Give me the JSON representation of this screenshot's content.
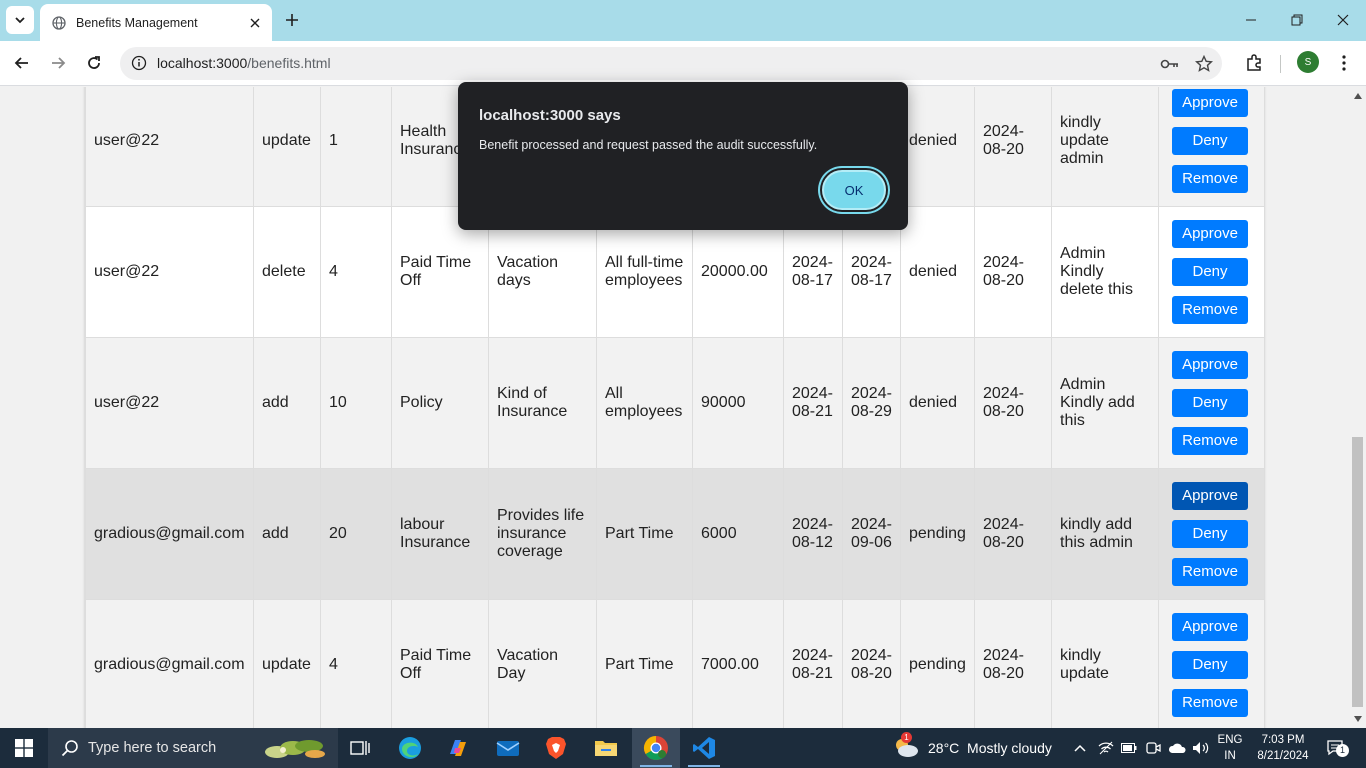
{
  "browser": {
    "tab_title": "Benefits Management",
    "url_host": "localhost:3000",
    "url_path": "/benefits.html"
  },
  "dialog": {
    "title": "localhost:3000 says",
    "message": "Benefit processed and request passed the audit successfully.",
    "ok_label": "OK"
  },
  "table": {
    "rows": [
      {
        "user": "user@22",
        "action": "update",
        "id": "1",
        "name_l1": "Health",
        "name_l2": "Insurance",
        "desc_l1": "",
        "desc_l2": "",
        "desc_l3": "",
        "elig_l1": "",
        "elig_l2": "",
        "amount": "",
        "start_l1": "",
        "start_l2": "",
        "end_l1": "",
        "end_l2": "",
        "status": "denied",
        "req_l1": "2024-",
        "req_l2": "08-20",
        "comment_l1": "kindly",
        "comment_l2": "update",
        "comment_l3": "admin",
        "approve": "Approve",
        "deny": "Deny",
        "remove": "Remove"
      },
      {
        "user": "user@22",
        "action": "delete",
        "id": "4",
        "name_l1": "Paid Time",
        "name_l2": "Off",
        "desc_l1": "Vacation",
        "desc_l2": "days",
        "desc_l3": "",
        "elig_l1": "All full-time",
        "elig_l2": "employees",
        "amount": "20000.00",
        "start_l1": "2024-",
        "start_l2": "08-17",
        "end_l1": "2024-",
        "end_l2": "08-17",
        "status": "denied",
        "req_l1": "2024-",
        "req_l2": "08-20",
        "comment_l1": "Admin",
        "comment_l2": "Kindly",
        "comment_l3": "delete this",
        "approve": "Approve",
        "deny": "Deny",
        "remove": "Remove"
      },
      {
        "user": "user@22",
        "action": "add",
        "id": "10",
        "name_l1": "Policy",
        "name_l2": "",
        "desc_l1": "Kind of",
        "desc_l2": "Insurance",
        "desc_l3": "",
        "elig_l1": "All",
        "elig_l2": "employees",
        "amount": "90000",
        "start_l1": "2024-",
        "start_l2": "08-21",
        "end_l1": "2024-",
        "end_l2": "08-29",
        "status": "denied",
        "req_l1": "2024-",
        "req_l2": "08-20",
        "comment_l1": "Admin",
        "comment_l2": "Kindly add",
        "comment_l3": "this",
        "approve": "Approve",
        "deny": "Deny",
        "remove": "Remove"
      },
      {
        "user": "gradious@gmail.com",
        "action": "add",
        "id": "20",
        "name_l1": "labour",
        "name_l2": "Insurance",
        "desc_l1": "Provides life",
        "desc_l2": "insurance",
        "desc_l3": "coverage",
        "elig_l1": "Part Time",
        "elig_l2": "",
        "amount": "6000",
        "start_l1": "2024-",
        "start_l2": "08-12",
        "end_l1": "2024-",
        "end_l2": "09-06",
        "status": "pending",
        "req_l1": "2024-",
        "req_l2": "08-20",
        "comment_l1": "kindly add",
        "comment_l2": "this admin",
        "comment_l3": "",
        "approve": "Approve",
        "deny": "Deny",
        "remove": "Remove"
      },
      {
        "user": "gradious@gmail.com",
        "action": "update",
        "id": "4",
        "name_l1": "Paid Time",
        "name_l2": "Off",
        "desc_l1": "Vacation",
        "desc_l2": "Day",
        "desc_l3": "",
        "elig_l1": "Part Time",
        "elig_l2": "",
        "amount": "7000.00",
        "start_l1": "2024-",
        "start_l2": "08-21",
        "end_l1": "2024-",
        "end_l2": "08-20",
        "status": "pending",
        "req_l1": "2024-",
        "req_l2": "08-20",
        "comment_l1": "kindly",
        "comment_l2": "update",
        "comment_l3": "",
        "approve": "Approve",
        "deny": "Deny",
        "remove": "Remove"
      }
    ]
  },
  "taskbar": {
    "search_placeholder": "Type here to search",
    "weather": "28°C  Mostly cloudy",
    "weather_badge": "1",
    "lang_l1": "ENG",
    "lang_l2": "IN",
    "time": "7:03 PM",
    "date": "8/21/2024",
    "notification_count": "1"
  },
  "profile_initial": "S",
  "colors": {
    "tabstrip": "#a8dce9",
    "button": "#007bff",
    "button_active": "#0056b3",
    "dialog_bg": "#202124",
    "ok_button": "#78d9ec",
    "taskbar": "#1c2c3c"
  }
}
